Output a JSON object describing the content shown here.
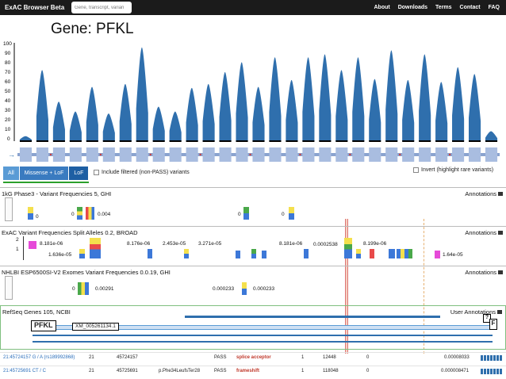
{
  "navbar": {
    "brand": "ExAC Browser Beta",
    "search_placeholder": "Gene, transcript, varian",
    "links": [
      "About",
      "Downloads",
      "Terms",
      "Contact",
      "FAQ"
    ]
  },
  "page_title": "Gene: PFKL",
  "coverage": {
    "y_ticks": [
      "100",
      "90",
      "80",
      "70",
      "60",
      "50",
      "40",
      "30",
      "20",
      "10",
      "0"
    ],
    "exon_peaks": [
      5,
      72,
      40,
      30,
      55,
      28,
      58,
      95,
      35,
      30,
      54,
      58,
      70,
      80,
      55,
      85,
      62,
      85,
      88,
      72,
      85,
      63,
      92,
      62,
      88,
      60,
      75,
      68,
      10
    ],
    "colors": {
      "area": "#2f6fad",
      "exon": "#a9bde0",
      "line": "#8aa3cf",
      "marker": "#d13a3a"
    }
  },
  "filters": {
    "all": "All",
    "missense_lof": "Missense + LoF",
    "lof": "LoF",
    "include_filtered": "Include filtered (non-PASS) variants",
    "invert": "Invert (highlight rare variants)"
  },
  "tracks": {
    "kg": {
      "label": "1kG Phase3 - Variant Frequencies 5, GHI",
      "annotations": "Annotations",
      "freqs": [
        "0",
        "0",
        "0.004",
        "0",
        "0"
      ]
    },
    "exac": {
      "label": "ExAC Variant Frequencies Split Alleles 0.2, BROAD",
      "annotations": "Annotations",
      "y_ticks": [
        "2",
        "1"
      ],
      "freqs": [
        "8.181e-06",
        "1.636e-05",
        "8.176e-06",
        "2.453e-05",
        "3.271e-05",
        "8.181e-06",
        "0.0002538",
        "8.199e-06",
        "1.64e-05"
      ]
    },
    "nhlbi": {
      "label": "NHLBI ESP6500SI-V2 Exomes Variant Frequencies 0.0.19, GHI",
      "annotations": "Annotations",
      "freqs": [
        "0",
        "0.00291",
        "0.000233",
        "0.000233"
      ]
    },
    "refseq": {
      "label": "RefSeq Genes 105, NCBI",
      "annotations": "User Annotations",
      "gene": "PFKL",
      "transcript": "XM_005261134.1",
      "question": "?",
      "f_button": "F"
    }
  },
  "variants_table": [
    {
      "variant": "21:45724157 G / A (rs189992868)",
      "chrom": "21",
      "pos": "45724157",
      "consequence": "",
      "filter": "PASS",
      "annotation": "splice acceptor",
      "ac": "1",
      "an": "12448",
      "hom": "0",
      "af": "0.00008033"
    },
    {
      "variant": "21:45725691 CT / C",
      "chrom": "21",
      "pos": "45725691",
      "consequence": "p.Phe34LeufsTer28",
      "filter": "PASS",
      "annotation": "frameshift",
      "ac": "1",
      "an": "118048",
      "hom": "0",
      "af": "0.000008471"
    }
  ]
}
